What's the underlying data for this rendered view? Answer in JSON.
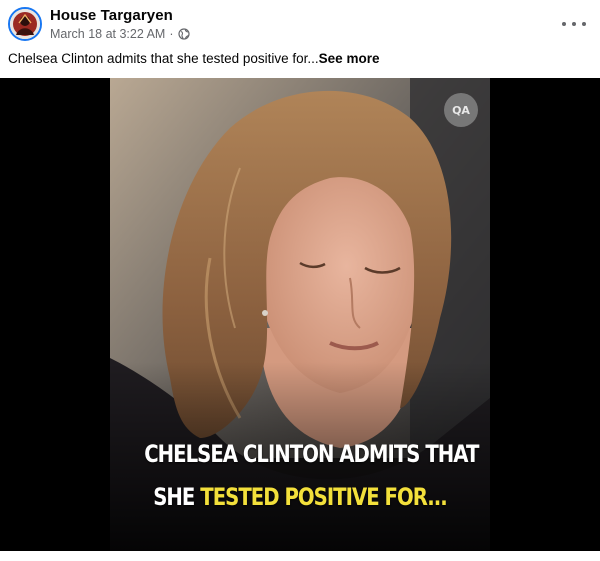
{
  "post": {
    "page_name": "House Targaryen",
    "timestamp": "March 18 at 3:22 AM",
    "separator": "·",
    "audience_icon": "globe-icon",
    "caption_text": "Chelsea Clinton admits that she tested positive for...",
    "see_more_label": "See more",
    "more_options_icon": "more-horizontal-icon"
  },
  "media": {
    "watermark": "QA",
    "headline_line1": "CHELSEA CLINTON ADMITS THAT",
    "headline_line2_part1": "SHE ",
    "headline_line2_highlight": "TESTED POSITIVE FOR...",
    "highlight_color": "#f3e03b"
  },
  "colors": {
    "avatar_ring": "#1877f2",
    "secondary_text": "#65676b"
  }
}
